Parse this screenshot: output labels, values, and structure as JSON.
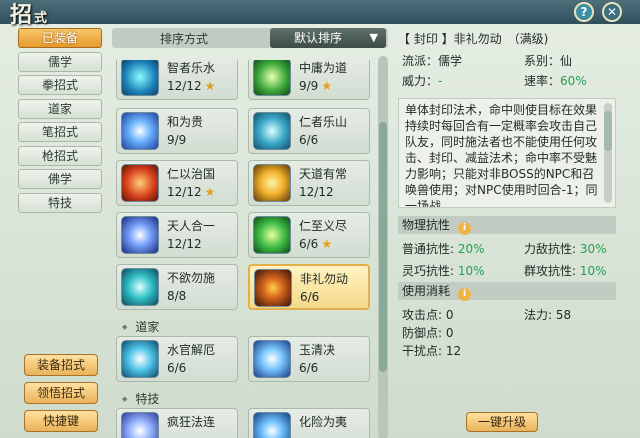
{
  "window": {
    "title_main": "招",
    "title_sub": "式",
    "help_icon": "?",
    "close_icon": "✕"
  },
  "nav": {
    "items": [
      {
        "label": "已装备",
        "active": true
      },
      {
        "label": "儒学"
      },
      {
        "label": "拳招式"
      },
      {
        "label": "道家"
      },
      {
        "label": "笔招式"
      },
      {
        "label": "枪招式"
      },
      {
        "label": "佛学"
      },
      {
        "label": "特技"
      }
    ]
  },
  "left_actions": {
    "equip": "装备招式",
    "learn": "领悟招式",
    "shortcut": "快捷键"
  },
  "sort": {
    "label": "排序方式",
    "selected": "默认排序",
    "caret": "▼"
  },
  "skills": {
    "s0": {
      "name": "智者乐水",
      "level": "12/12",
      "star": "★"
    },
    "s1": {
      "name": "中庸为道",
      "level": "9/9",
      "star": "★"
    },
    "s2": {
      "name": "和为贵",
      "level": "9/9"
    },
    "s3": {
      "name": "仁者乐山",
      "level": "6/6"
    },
    "s4": {
      "name": "仁以治国",
      "level": "12/12",
      "star": "★"
    },
    "s5": {
      "name": "天道有常",
      "level": "12/12"
    },
    "s6": {
      "name": "天人合一",
      "level": "12/12"
    },
    "s7": {
      "name": "仁至义尽",
      "level": "6/6",
      "star": "★"
    },
    "s8": {
      "name": "不欲勿施",
      "level": "8/8"
    },
    "s9": {
      "name": "非礼勿动",
      "level": "6/6"
    },
    "s10": {
      "name": "水官解厄",
      "level": "6/6"
    },
    "s11": {
      "name": "玉清决",
      "level": "6/6"
    },
    "s12": {
      "name": "疯狂法连",
      "level": ""
    },
    "s13": {
      "name": "化险为夷",
      "level": ""
    }
  },
  "groups": {
    "daojia": "道家",
    "teji": "特技"
  },
  "detail": {
    "title": "【 封印 】非礼勿动　（满级)",
    "school_label": "流派：",
    "school": "儒学",
    "series_label": "系别：",
    "series": "仙",
    "power_label": "威力：",
    "power": "-",
    "speed_label": "速率：",
    "speed": "60%",
    "description": "单体封印法术，命中则使目标在效果持续时每回合有一定概率会攻击自己队友，同时施法者也不能使用任何攻击、封印、减益法术；命中率不受魅力影响；只能对非BOSS的NPC和召唤兽使用；对NPC使用时回合-1；同一场战",
    "physical_resist_label": "物理抗性",
    "info_icon": "i",
    "resist": {
      "normal_label": "普通抗性:",
      "normal": "20%",
      "strength_label": "力敌抗性:",
      "strength": "30%",
      "agile_label": "灵巧抗性:",
      "agile": "10%",
      "group_label": "群攻抗性:",
      "group": "10%"
    },
    "cost_label": "使用消耗",
    "cost": {
      "attack_label": "攻击点:",
      "attack": "0",
      "mana_label": "法力:",
      "mana": "58",
      "defense_label": "防御点:",
      "defense": "0",
      "interfere_label": "干扰点:",
      "interfere": "12"
    },
    "upgrade": "一键升级"
  }
}
